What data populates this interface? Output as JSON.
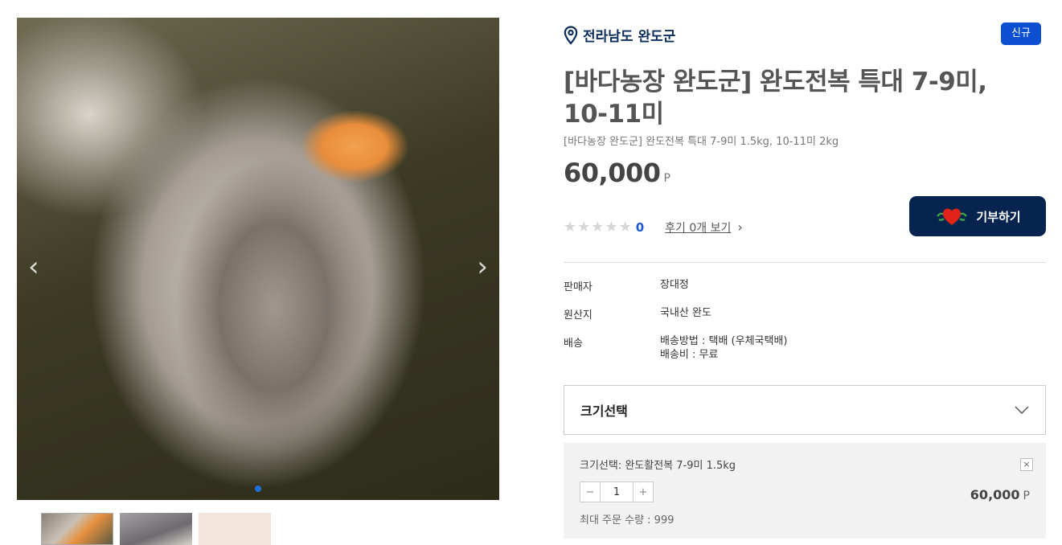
{
  "gallery": {
    "prev_icon": "chevron-left-icon",
    "next_icon": "chevron-right-icon",
    "active_dot_color": "#1f6fd8"
  },
  "product": {
    "location": "전라남도 완도군",
    "badge": "신규",
    "title": "[바다농장 완도군] 완도전복 특대 7-9미, 10-11미",
    "subtitle": "[바다농장 완도군] 완도전복 특대 7-9미 1.5kg, 10-11미 2kg",
    "price": "60,000",
    "price_unit": "P",
    "rating_count": "0",
    "review_link": "후기 0개 보기",
    "donate_label": "기부하기"
  },
  "specs": [
    {
      "label": "판매자",
      "value": "장대정"
    },
    {
      "label": "원산지",
      "value": "국내산 완도"
    },
    {
      "label": "배송",
      "value": "배송방법 : 택배 (우체국택배)",
      "value2": "배송비 : 무료"
    }
  ],
  "option_select": {
    "label": "크기선택"
  },
  "selected_item": {
    "name": "크기선택: 완도활전복 7-9미 1.5kg",
    "close": "×",
    "minus": "−",
    "quantity": "1",
    "plus": "+",
    "price": "60,000",
    "price_unit": "P",
    "max_qty": "최대 주문 수량 : 999"
  },
  "colors": {
    "accent_blue": "#0c4fd0",
    "navy": "#06244f",
    "location_text": "#0a2d5c"
  }
}
